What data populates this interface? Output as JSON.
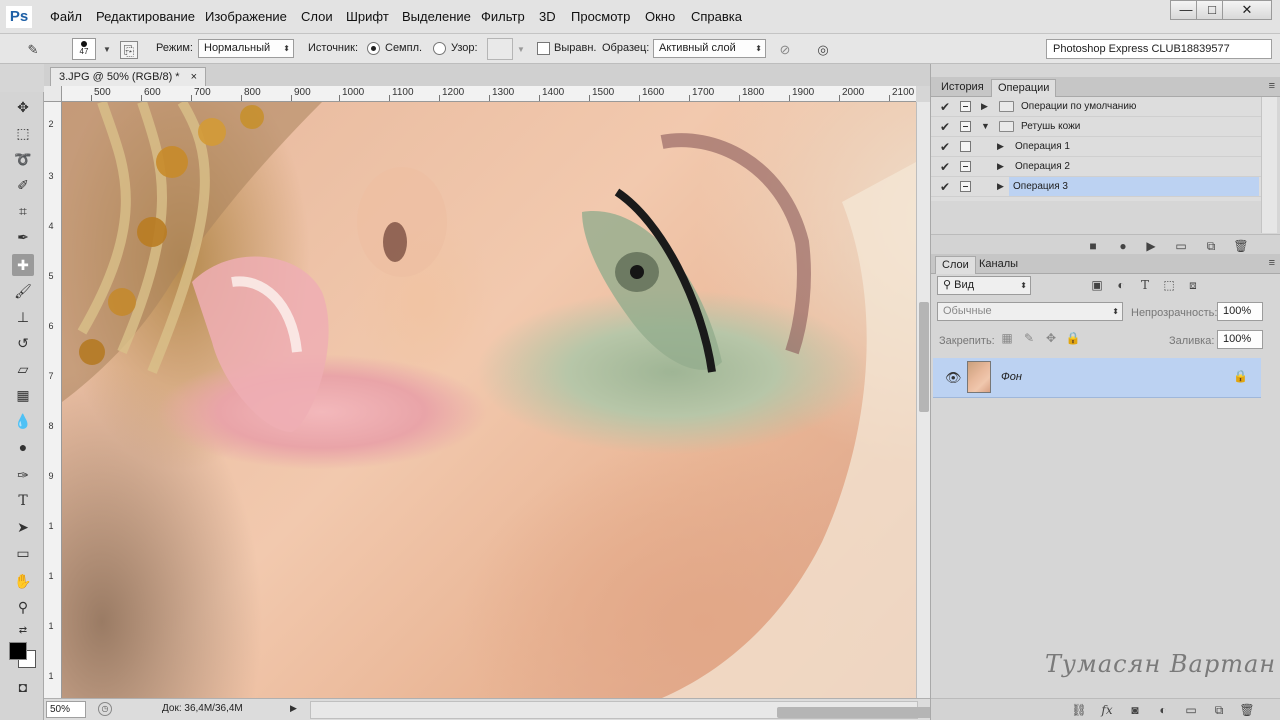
{
  "app": {
    "logo": "Ps"
  },
  "menu": [
    "Файл",
    "Редактирование",
    "Изображение",
    "Слои",
    "Шрифт",
    "Выделение",
    "Фильтр",
    "3D",
    "Просмотр",
    "Окно",
    "Справка"
  ],
  "window_controls": {
    "minimize": "—",
    "maximize": "□",
    "close": "✕"
  },
  "options": {
    "brush_size": "47",
    "mode_label": "Режим:",
    "mode_value": "Нормальный",
    "source_label": "Источник:",
    "sampled_label": "Семпл.",
    "pattern_label": "Узор:",
    "aligned_label": "Выравн.",
    "sample_label": "Образец:",
    "sample_value": "Активный слой"
  },
  "workspace": "Photoshop Express CLUB18839577",
  "document": {
    "tab_title": "3.JPG @ 50% (RGB/8) *",
    "tab_close": "×",
    "ruler_top": [
      "500",
      "600",
      "700",
      "800",
      "900",
      "1000",
      "1100",
      "1200",
      "1300",
      "1400",
      "1500",
      "1600",
      "1700",
      "1800",
      "1900",
      "2000",
      "2100"
    ],
    "ruler_left": [
      "2",
      "3",
      "4",
      "5",
      "6",
      "7",
      "8",
      "9",
      "1",
      "1",
      "1",
      "1"
    ]
  },
  "status": {
    "zoom": "50%",
    "doc_info": "Док: 36,4M/36,4M"
  },
  "actions_panel": {
    "tabs": [
      "История",
      "Операции"
    ],
    "active_tab": 1,
    "rows": [
      {
        "name": "Операции по умолчанию",
        "level": 0,
        "type": "folder",
        "expanded": false,
        "selected": false,
        "dialog": true
      },
      {
        "name": "Ретушь кожи",
        "level": 0,
        "type": "folder",
        "expanded": true,
        "selected": false,
        "dialog": true
      },
      {
        "name": "Операция 1",
        "level": 1,
        "type": "action",
        "expanded": false,
        "selected": false,
        "dialog": false
      },
      {
        "name": "Операция 2",
        "level": 1,
        "type": "action",
        "expanded": false,
        "selected": false,
        "dialog": true
      },
      {
        "name": "Операция 3",
        "level": 1,
        "type": "action",
        "expanded": false,
        "selected": true,
        "dialog": true
      }
    ]
  },
  "layers_panel": {
    "tabs": [
      "Слои",
      "Каналы"
    ],
    "active_tab": 0,
    "filter_value": "Вид",
    "blend_value": "Обычные",
    "opacity_label": "Непрозрачность:",
    "opacity_value": "100%",
    "lock_label": "Закрепить:",
    "fill_label": "Заливка:",
    "fill_value": "100%",
    "layer_name": "Фон"
  },
  "watermark": "Тумасян Вартан",
  "colors": {
    "selection": "#bcd2f2",
    "panel": "#d6d6d6",
    "ps_blue": "#1d5fa6"
  }
}
